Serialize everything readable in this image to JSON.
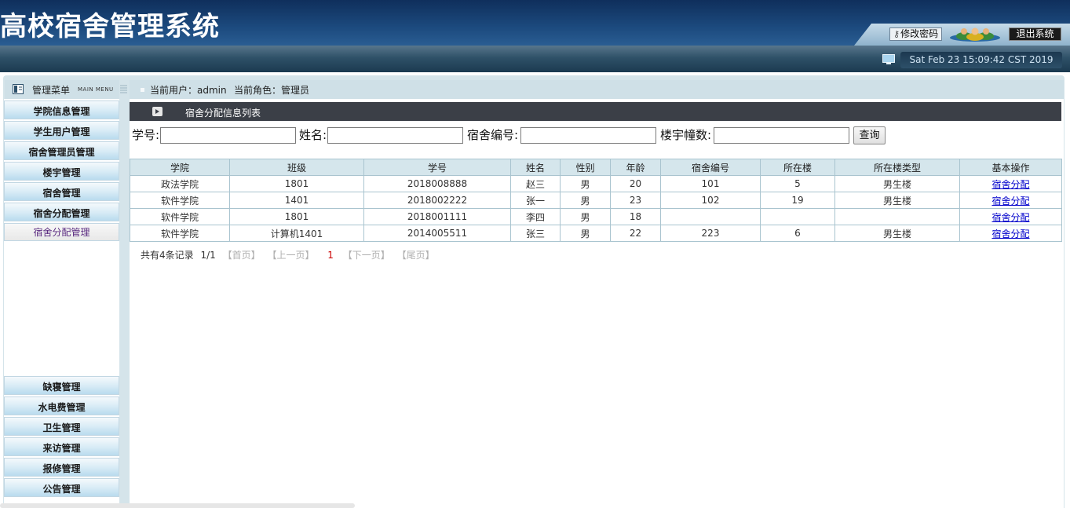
{
  "app": {
    "title": "高校宿舍管理系统"
  },
  "header": {
    "change_password": "修改密码",
    "logout": "退出系统",
    "datetime": "Sat Feb 23 15:09:42 CST 2019"
  },
  "menu": {
    "label": "管理菜单",
    "label_en": "MAIN MENU"
  },
  "userbar": {
    "current_user": "当前用户：admin",
    "current_role": "当前角色：管理员"
  },
  "sidebar": {
    "top_items": [
      {
        "label": "学院信息管理"
      },
      {
        "label": "学生用户管理"
      },
      {
        "label": "宿舍管理员管理"
      },
      {
        "label": "楼宇管理"
      },
      {
        "label": "宿舍管理"
      },
      {
        "label": "宿舍分配管理"
      },
      {
        "label": "宿舍分配管理",
        "active": true
      }
    ],
    "bottom_items": [
      {
        "label": "缺寝管理"
      },
      {
        "label": "水电费管理"
      },
      {
        "label": "卫生管理"
      },
      {
        "label": "来访管理"
      },
      {
        "label": "报修管理"
      },
      {
        "label": "公告管理"
      }
    ]
  },
  "list": {
    "title": "宿舍分配信息列表",
    "search": {
      "student_no_label": "学号:",
      "name_label": "姓名:",
      "dorm_no_label": "宿舍编号:",
      "building_label": "楼宇幢数:",
      "query_button": "查询"
    },
    "columns": [
      "学院",
      "班级",
      "学号",
      "姓名",
      "性别",
      "年龄",
      "宿舍编号",
      "所在楼",
      "所在楼类型",
      "基本操作"
    ],
    "rows": [
      {
        "college": "政法学院",
        "class": "1801",
        "student_no": "2018008888",
        "name": "赵三",
        "gender": "男",
        "age": "20",
        "dorm_no": "101",
        "building": "5",
        "building_type": "男生楼",
        "action": "宿舍分配"
      },
      {
        "college": "软件学院",
        "class": "1401",
        "student_no": "2018002222",
        "name": "张一",
        "gender": "男",
        "age": "23",
        "dorm_no": "102",
        "building": "19",
        "building_type": "男生楼",
        "action": "宿舍分配"
      },
      {
        "college": "软件学院",
        "class": "1801",
        "student_no": "2018001111",
        "name": "李四",
        "gender": "男",
        "age": "18",
        "dorm_no": "",
        "building": "",
        "building_type": "",
        "action": "宿舍分配"
      },
      {
        "college": "软件学院",
        "class": "计算机1401",
        "student_no": "2014005511",
        "name": "张三",
        "gender": "男",
        "age": "22",
        "dorm_no": "223",
        "building": "6",
        "building_type": "男生楼",
        "action": "宿舍分配"
      }
    ],
    "pager": {
      "total": "共有4条记录",
      "pages": "1/1",
      "first": "【首页】",
      "prev": "【上一页】",
      "current": "1",
      "next": "【下一页】",
      "last": "【尾页】"
    }
  },
  "colors": {
    "header_bg": "#1c4a7e",
    "subbar_bg": "#2f5168",
    "frame_bg": "#d5e4ea",
    "list_title_bg": "#3b3f47",
    "link": "#0000cc",
    "pager_current": "#cc0000"
  }
}
